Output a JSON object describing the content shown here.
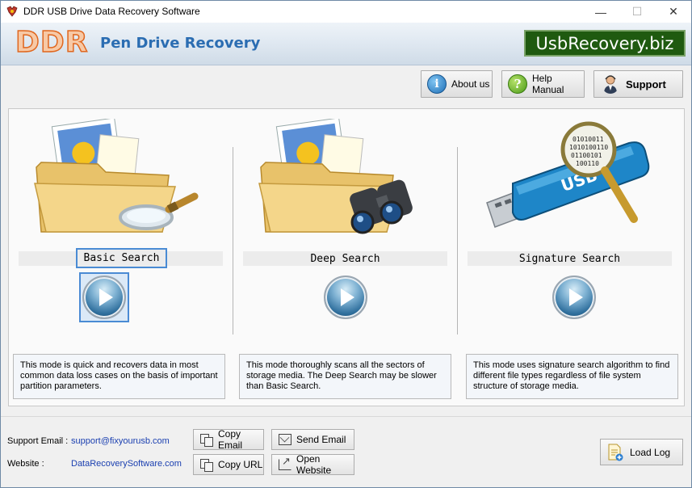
{
  "window": {
    "title": "DDR USB Drive Data Recovery Software",
    "controls": {
      "minimize": "—",
      "maximize": "☐",
      "close": "✕"
    }
  },
  "header": {
    "logo": "DDR",
    "product": "Pen Drive Recovery",
    "site": "UsbRecovery.biz",
    "accent_color": "#2b6db2"
  },
  "toolbar": {
    "about": "About us",
    "help": "Help Manual",
    "support": "Support"
  },
  "modes": [
    {
      "label": "Basic Search",
      "icon": "folder-magnifier-icon",
      "description": "This mode is quick and recovers data in most common data loss cases on the basis of important partition parameters.",
      "focused": true
    },
    {
      "label": "Deep Search",
      "icon": "folder-binoculars-icon",
      "description": "This mode thoroughly scans all the sectors of storage media. The Deep Search may be slower than Basic Search.",
      "focused": false
    },
    {
      "label": "Signature Search",
      "icon": "usb-magnifier-icon",
      "description": "This mode uses signature search algorithm to find different file types regardless of file system structure of storage media.",
      "focused": false
    }
  ],
  "footer": {
    "support_email_label": "Support Email :",
    "support_email": "support@fixyourusb.com",
    "website_label": "Website :",
    "website": "DataRecoverySoftware.com",
    "copy_email": "Copy Email",
    "send_email": "Send Email",
    "copy_url": "Copy URL",
    "open_website": "Open Website",
    "load_log": "Load Log"
  }
}
